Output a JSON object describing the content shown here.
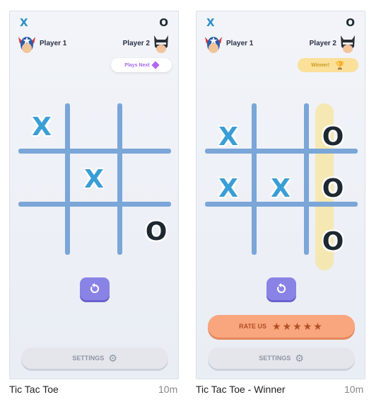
{
  "screens": [
    {
      "caption": "Tic Tac Toe",
      "duration": "10m",
      "score_x": "X",
      "score_o": "O",
      "player1": "Player 1",
      "player2": "Player 2",
      "status_label": "Plays Next",
      "board": [
        "X",
        "",
        "",
        "",
        "X",
        "",
        "",
        "",
        "O"
      ],
      "settings_label": "SETTINGS"
    },
    {
      "caption": "Tic Tac Toe - Winner",
      "duration": "10m",
      "score_x": "X",
      "score_o": "O",
      "player1": "Player 1",
      "player2": "Player 2",
      "status_label": "Winner!",
      "board": [
        "X",
        "",
        "O",
        "X",
        "X",
        "O",
        "",
        "",
        "O"
      ],
      "rate_label": "RATE US",
      "rate_stars": 5,
      "settings_label": "SETTINGS"
    }
  ],
  "colors": {
    "x_mark": "#3a9ed6",
    "o_mark": "#1e2830",
    "grid": "#7aa6d8",
    "refresh_button": "#8a83e6",
    "rate_button": "#f9a57d",
    "winner_pill": "#fbe09a",
    "winning_line": "#fae496"
  },
  "icons": [
    "captain-america-avatar-icon",
    "batman-avatar-icon",
    "gem-icon",
    "trophy-icon",
    "restart-icon",
    "star-icon",
    "gear-icon"
  ]
}
